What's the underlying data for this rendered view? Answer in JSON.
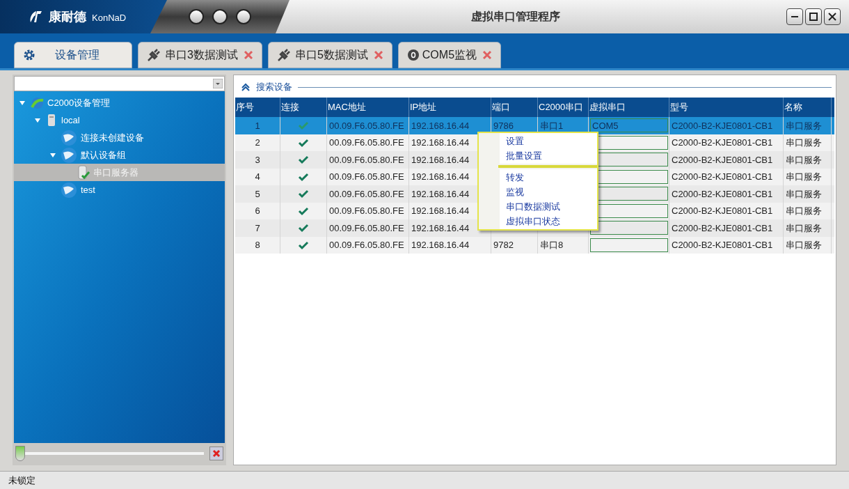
{
  "window": {
    "logo_text": "康耐德",
    "logo_latin": "KonNaD",
    "title": "虚拟串口管理程序"
  },
  "tabs": [
    {
      "label": "设备管理",
      "kind": "gear",
      "closable": false,
      "selected": true
    },
    {
      "label": "串口3数据测试",
      "kind": "plug",
      "closable": true,
      "selected": false
    },
    {
      "label": "串口5数据测试",
      "kind": "plug",
      "closable": true,
      "selected": false
    },
    {
      "label": "COM5监视",
      "kind": "monitor",
      "closable": true,
      "selected": false
    }
  ],
  "sidebar": {
    "tree": [
      {
        "label": "C2000设备管理",
        "kind": "root",
        "expanded": true,
        "selected": false,
        "children": [
          {
            "label": "local",
            "kind": "server",
            "expanded": true,
            "selected": false,
            "children": [
              {
                "label": "连接未创建设备",
                "kind": "globe",
                "selected": false
              },
              {
                "label": "默认设备组",
                "kind": "globe",
                "expanded": true,
                "selected": false,
                "children": [
                  {
                    "label": "串口服务器",
                    "kind": "device",
                    "selected": true
                  }
                ]
              },
              {
                "label": "test",
                "kind": "globe",
                "selected": false
              }
            ]
          }
        ]
      }
    ],
    "zoom_slider": {
      "level": 0
    }
  },
  "section": {
    "title": "搜索设备"
  },
  "table": {
    "columns": [
      "序号",
      "连接",
      "MAC地址",
      "IP地址",
      "端口",
      "C2000串口",
      "虚拟串口",
      "型号",
      "名称"
    ],
    "rows": [
      {
        "index": "1",
        "connected": true,
        "mac": "00.09.F6.05.80.FE",
        "ip": "192.168.16.44",
        "port": "9786",
        "serial": "串口1",
        "virtual_port": "COM5",
        "model": "C2000-B2-KJE0801-CB1",
        "name": "串口服务",
        "selected": true
      },
      {
        "index": "2",
        "connected": true,
        "mac": "00.09.F6.05.80.FE",
        "ip": "192.168.16.44",
        "model": "C2000-B2-KJE0801-CB1",
        "name": "串口服务",
        "selected": false
      },
      {
        "index": "3",
        "connected": true,
        "mac": "00.09.F6.05.80.FE",
        "ip": "192.168.16.44",
        "model": "C2000-B2-KJE0801-CB1",
        "name": "串口服务",
        "selected": false
      },
      {
        "index": "4",
        "connected": true,
        "mac": "00.09.F6.05.80.FE",
        "ip": "192.168.16.44",
        "model": "C2000-B2-KJE0801-CB1",
        "name": "串口服务",
        "selected": false
      },
      {
        "index": "5",
        "connected": true,
        "mac": "00.09.F6.05.80.FE",
        "ip": "192.168.16.44",
        "model": "C2000-B2-KJE0801-CB1",
        "name": "串口服务",
        "selected": false
      },
      {
        "index": "6",
        "connected": true,
        "mac": "00.09.F6.05.80.FE",
        "ip": "192.168.16.44",
        "model": "C2000-B2-KJE0801-CB1",
        "name": "串口服务",
        "selected": false
      },
      {
        "index": "7",
        "connected": true,
        "mac": "00.09.F6.05.80.FE",
        "ip": "192.168.16.44",
        "model": "C2000-B2-KJE0801-CB1",
        "name": "串口服务",
        "selected": false
      },
      {
        "index": "8",
        "connected": true,
        "mac": "00.09.F6.05.80.FE",
        "ip": "192.168.16.44",
        "port": "9782",
        "serial": "串口8",
        "model": "C2000-B2-KJE0801-CB1",
        "name": "串口服务",
        "selected": false
      }
    ]
  },
  "context_menu": {
    "groups": [
      [
        "设置",
        "批量设置"
      ],
      [
        "转发",
        "监视",
        "串口数据测试",
        "虚拟串口状态"
      ]
    ]
  },
  "status_bar": "未锁定"
}
